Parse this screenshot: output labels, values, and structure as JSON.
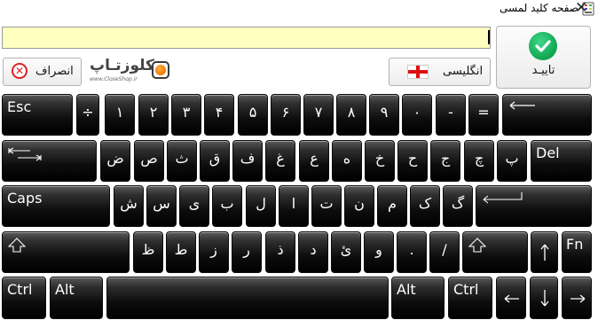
{
  "window": {
    "title": "صفحه کلید لمسی",
    "close_glyph": "✕"
  },
  "input": {
    "value": ""
  },
  "buttons": {
    "confirm_label": "تاییـد",
    "cancel_label": "انصراف",
    "english_label": "انگلیسی"
  },
  "logo": {
    "text": "کلوزتـاپ",
    "subtext": "www.CloseShop.ir"
  },
  "colors": {
    "input_bg": "#ffffc0",
    "key_bg": "#000000",
    "key_text": "#ffffff",
    "confirm_accent": "#10a44f",
    "cancel_accent": "#dd2222"
  },
  "rows": [
    [
      "Esc",
      "÷",
      "۱",
      "۲",
      "۳",
      "۴",
      "۵",
      "۶",
      "۷",
      "۸",
      "۹",
      "۰",
      "-",
      "=",
      "backspace"
    ],
    [
      "tab",
      "ض",
      "ص",
      "ث",
      "ق",
      "ف",
      "غ",
      "ع",
      "ه",
      "خ",
      "ح",
      "ج",
      "چ",
      "پ",
      "Del"
    ],
    [
      "Caps",
      "ش",
      "س",
      "ی",
      "ب",
      "ل",
      "ا",
      "ت",
      "ن",
      "م",
      "ک",
      "گ",
      "enter"
    ],
    [
      "shift-left",
      "ظ",
      "ط",
      "ز",
      "ر",
      "ذ",
      "د",
      "ئ",
      "و",
      ".",
      "/",
      "shift-right",
      "up",
      "Fn"
    ],
    [
      "Ctrl",
      "Alt",
      "space",
      "Alt",
      "Ctrl",
      "left",
      "down",
      "right"
    ]
  ],
  "icons": {
    "app": "keyboard-app-icon",
    "backspace": "backspace-arrow-icon",
    "tab": "tab-arrows-icon",
    "enter": "enter-arrow-icon",
    "shift": "shift-arrow-icon",
    "up": "up-arrow-icon",
    "down": "down-arrow-icon",
    "left": "left-arrow-icon",
    "right": "right-arrow-icon",
    "confirm": "check-icon",
    "cancel": "x-circle-icon",
    "flag": "english-flag-icon"
  }
}
